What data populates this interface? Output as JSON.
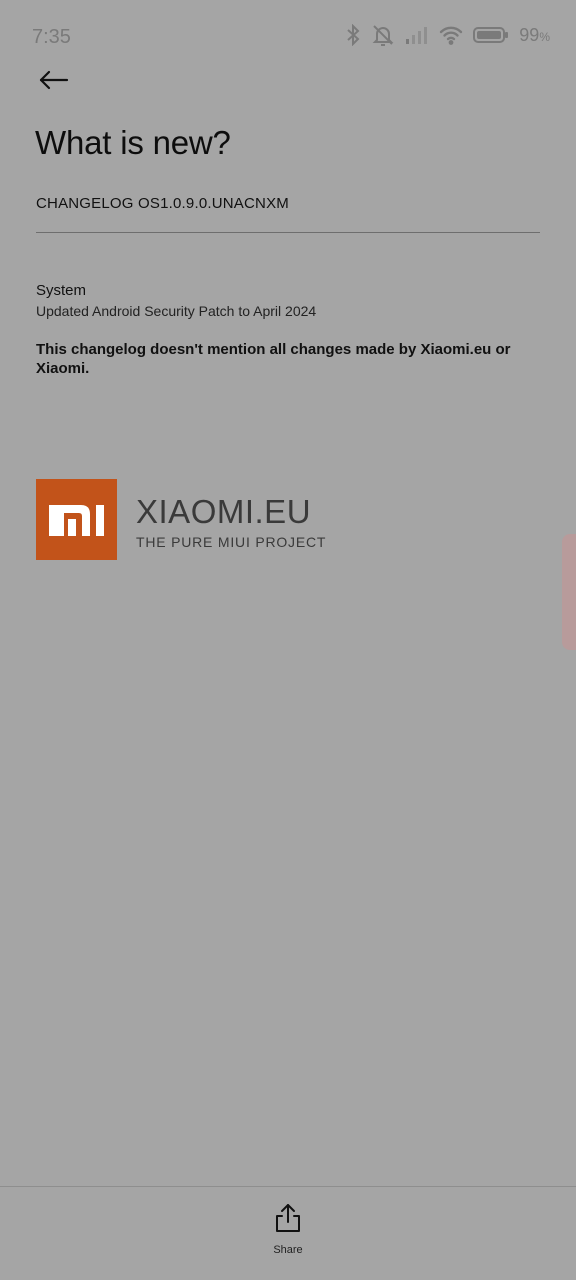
{
  "status_bar": {
    "time": "7:35",
    "battery_percent": "99",
    "battery_unit": "%",
    "icons": [
      "bluetooth-icon",
      "alarm-off-icon",
      "signal-icon",
      "wifi-icon",
      "battery-icon"
    ]
  },
  "header": {
    "back_icon": "arrow-left-icon",
    "title": "What is new?"
  },
  "changelog": {
    "version_label": "CHANGELOG OS1.0.9.0.UNACNXM",
    "sections": [
      {
        "heading": "System",
        "body": "Updated Android Security Patch to April 2024"
      }
    ],
    "note": "This changelog doesn't mention all changes made by Xiaomi.eu or Xiaomi."
  },
  "branding": {
    "logo_mark": "mi-logo",
    "logo_color": "#c2531a",
    "name": "XIAOMI.EU",
    "tagline": "THE PURE MIUI PROJECT"
  },
  "footer": {
    "share_icon": "share-icon",
    "share_label": "Share"
  }
}
